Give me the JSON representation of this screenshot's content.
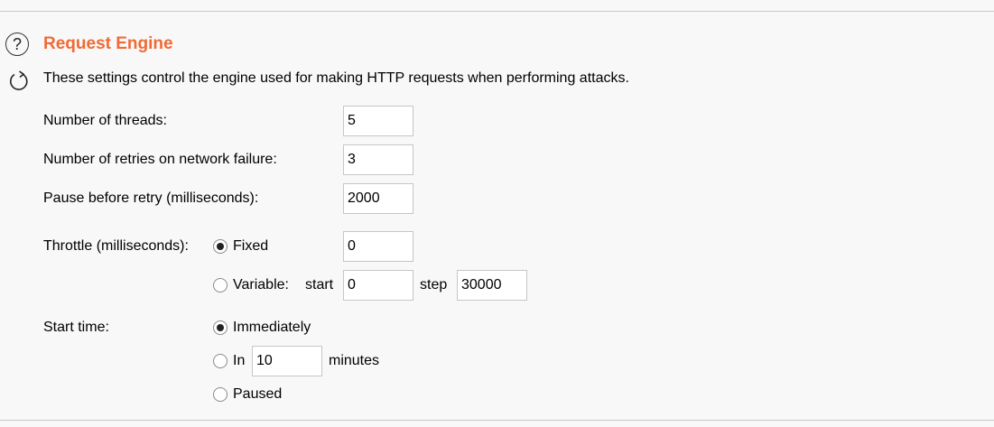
{
  "panel": {
    "title": "Request Engine",
    "description": "These settings control the engine used for making HTTP requests when performing attacks."
  },
  "threads": {
    "label": "Number of threads:",
    "value": "5"
  },
  "retries": {
    "label": "Number of retries on network failure:",
    "value": "3"
  },
  "pause": {
    "label": "Pause before retry (milliseconds):",
    "value": "2000"
  },
  "throttle": {
    "label": "Throttle (milliseconds):",
    "fixed_label": "Fixed",
    "fixed_value": "0",
    "fixed_selected": true,
    "variable_label": "Variable:",
    "start_label": "start",
    "start_value": "0",
    "step_label": "step",
    "step_value": "30000",
    "variable_selected": false
  },
  "start_time": {
    "label": "Start time:",
    "immediately_label": "Immediately",
    "immediately_selected": true,
    "in_label": "In",
    "in_value": "10",
    "minutes_label": "minutes",
    "in_selected": false,
    "paused_label": "Paused",
    "paused_selected": false
  },
  "icons": {
    "help": "help-icon",
    "refresh": "refresh-icon"
  },
  "colors": {
    "title": "#f06a35",
    "background": "#f8f8f8"
  }
}
